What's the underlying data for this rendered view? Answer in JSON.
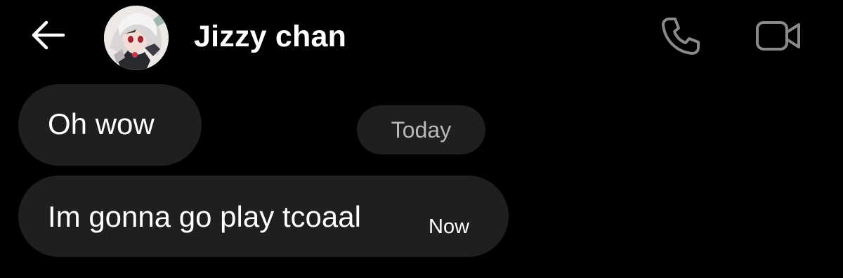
{
  "header": {
    "back_icon": "arrow-left-icon",
    "contact_name": "Jizzy chan",
    "avatar": "anime-character-avatar",
    "call_icon": "phone-icon",
    "video_icon": "video-camera-icon"
  },
  "date_divider": "Today",
  "messages": [
    {
      "text": "Oh wow"
    },
    {
      "text": "Im gonna go play tcoaal",
      "time": "Now"
    }
  ],
  "colors": {
    "background": "#000000",
    "bubble": "#1f1f1f",
    "icon_gray": "#8a8a8a",
    "date_text": "#b8b8b8"
  }
}
